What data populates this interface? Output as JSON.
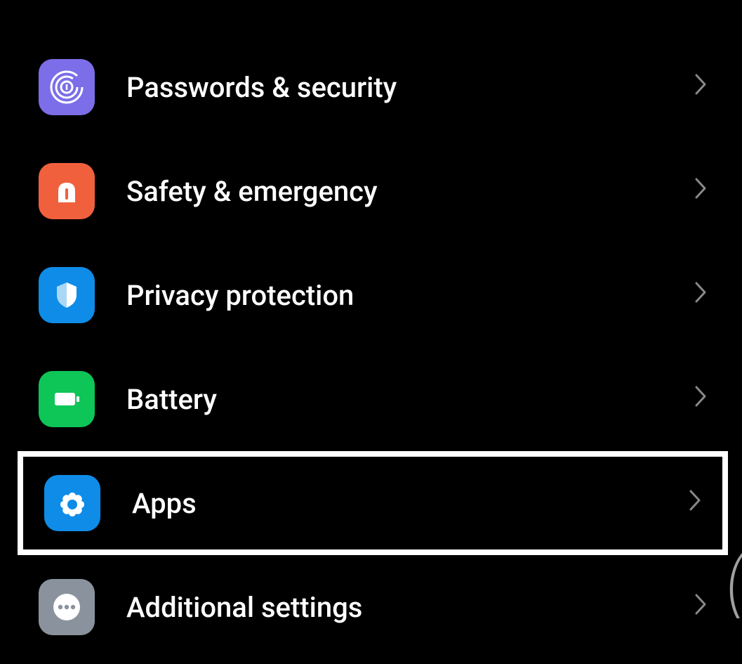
{
  "settings": {
    "items": [
      {
        "label": "Passwords & security",
        "icon": "fingerprint-icon",
        "bg": "bg-purple",
        "highlighted": false
      },
      {
        "label": "Safety & emergency",
        "icon": "emergency-icon",
        "bg": "bg-orange",
        "highlighted": false
      },
      {
        "label": "Privacy protection",
        "icon": "shield-icon",
        "bg": "bg-blue",
        "highlighted": false
      },
      {
        "label": "Battery",
        "icon": "battery-icon",
        "bg": "bg-green",
        "highlighted": false
      },
      {
        "label": "Apps",
        "icon": "apps-icon",
        "bg": "bg-blue2",
        "highlighted": true
      },
      {
        "label": "Additional settings",
        "icon": "more-icon",
        "bg": "bg-gray",
        "highlighted": false
      }
    ]
  }
}
